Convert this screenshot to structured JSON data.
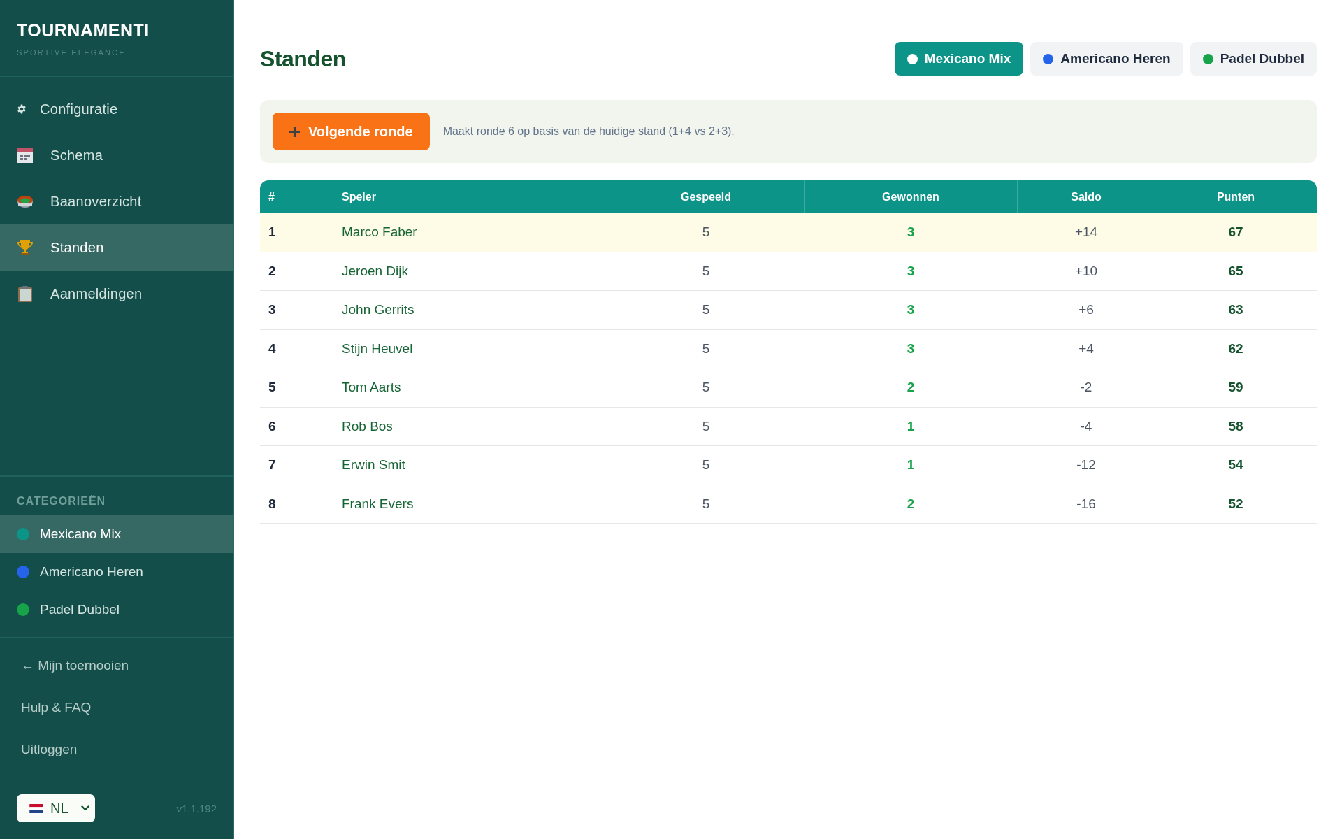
{
  "sidebar": {
    "logo": {
      "title": "TOURNAMENTI",
      "subtitle": "SPORTIVE ELEGANCE"
    },
    "nav": [
      {
        "label": "Configuratie",
        "selected": false
      },
      {
        "label": "Schema",
        "selected": false
      },
      {
        "label": "Baanoverzicht",
        "selected": false
      },
      {
        "label": "Standen",
        "selected": true
      },
      {
        "label": "Aanmeldingen",
        "selected": false
      }
    ],
    "categories": {
      "heading": "CATEGORIEËN",
      "items": [
        {
          "label": "Mexicano Mix",
          "color": "#0d9488",
          "selected": true
        },
        {
          "label": "Americano Heren",
          "color": "#2563eb",
          "selected": false
        },
        {
          "label": "Padel Dubbel",
          "color": "#16a34a",
          "selected": false
        }
      ]
    },
    "links": [
      "← Mijn toernooien",
      "Hulp & FAQ",
      "Uitloggen"
    ],
    "language_select": {
      "value": "NL"
    },
    "version": "v1.1.192"
  },
  "page": {
    "title": "Standen",
    "tabs": [
      {
        "label": "Mexicano Mix",
        "color": "#0d9488",
        "selected": true
      },
      {
        "label": "Americano Heren",
        "color": "#2563eb",
        "selected": false
      },
      {
        "label": "Padel Dubbel",
        "color": "#16a34a",
        "selected": false
      }
    ]
  },
  "action": {
    "button": "Volgende ronde",
    "hint": "Maakt ronde 6 op basis van de huidige stand (1+4 vs 2+3)."
  },
  "table": {
    "columns": [
      "#",
      "Speler",
      "Gespeeld",
      "Gewonnen",
      "Saldo",
      "Punten"
    ],
    "rows": [
      {
        "rank": "1",
        "player": "Marco Faber",
        "played": "5",
        "won": "3",
        "balance": "+14",
        "points": "67",
        "highlighted": true
      },
      {
        "rank": "2",
        "player": "Jeroen Dijk",
        "played": "5",
        "won": "3",
        "balance": "+10",
        "points": "65",
        "highlighted": false
      },
      {
        "rank": "3",
        "player": "John Gerrits",
        "played": "5",
        "won": "3",
        "balance": "+6",
        "points": "63",
        "highlighted": false
      },
      {
        "rank": "4",
        "player": "Stijn Heuvel",
        "played": "5",
        "won": "3",
        "balance": "+4",
        "points": "62",
        "highlighted": false
      },
      {
        "rank": "5",
        "player": "Tom Aarts",
        "played": "5",
        "won": "2",
        "balance": "-2",
        "points": "59",
        "highlighted": false
      },
      {
        "rank": "6",
        "player": "Rob Bos",
        "played": "5",
        "won": "1",
        "balance": "-4",
        "points": "58",
        "highlighted": false
      },
      {
        "rank": "7",
        "player": "Erwin Smit",
        "played": "5",
        "won": "1",
        "balance": "-12",
        "points": "54",
        "highlighted": false
      },
      {
        "rank": "8",
        "player": "Frank Evers",
        "played": "5",
        "won": "2",
        "balance": "-16",
        "points": "52",
        "highlighted": false
      }
    ]
  }
}
